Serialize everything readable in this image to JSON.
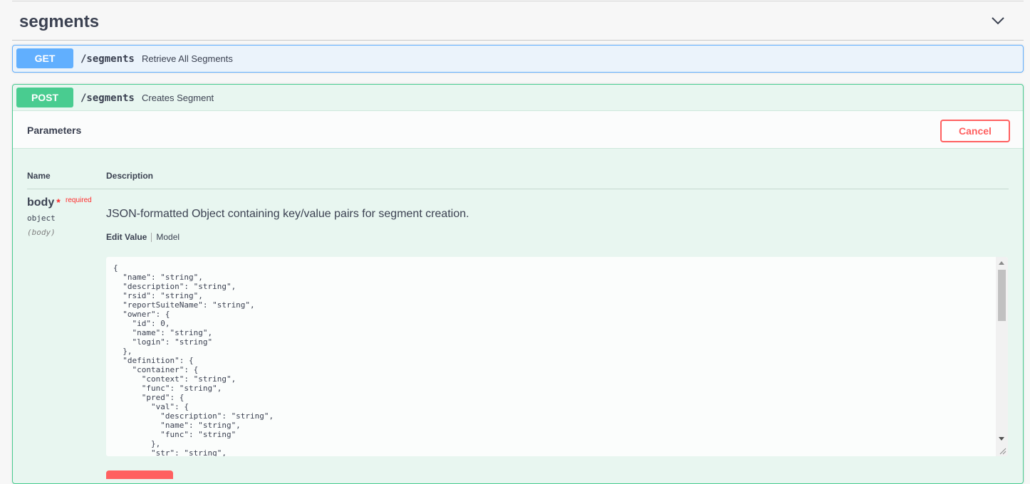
{
  "tag": {
    "title": "segments"
  },
  "operations": [
    {
      "method": "GET",
      "path": "/segments",
      "summary": "Retrieve All Segments",
      "color": "#61affe"
    },
    {
      "method": "POST",
      "path": "/segments",
      "summary": "Creates Segment",
      "color": "#49cc90"
    }
  ],
  "parameters": {
    "section_title": "Parameters",
    "cancel_label": "Cancel",
    "columns": {
      "name": "Name",
      "description": "Description"
    },
    "body": {
      "name": "body",
      "required_mark": "*",
      "required_label": "required",
      "type": "object",
      "in": "(body)",
      "description": "JSON-formatted Object containing key/value pairs for segment creation.",
      "tabs": [
        "Edit Value",
        "Model"
      ],
      "value": "{\n  \"name\": \"string\",\n  \"description\": \"string\",\n  \"rsid\": \"string\",\n  \"reportSuiteName\": \"string\",\n  \"owner\": {\n    \"id\": 0,\n    \"name\": \"string\",\n    \"login\": \"string\"\n  },\n  \"definition\": {\n    \"container\": {\n      \"context\": \"string\",\n      \"func\": \"string\",\n      \"pred\": {\n        \"val\": {\n          \"description\": \"string\",\n          \"name\": \"string\",\n          \"func\": \"string\"\n        },\n        \"str\": \"string\","
    }
  },
  "colors": {
    "cancel": "#ff6060",
    "required": "#ff2d2d"
  }
}
